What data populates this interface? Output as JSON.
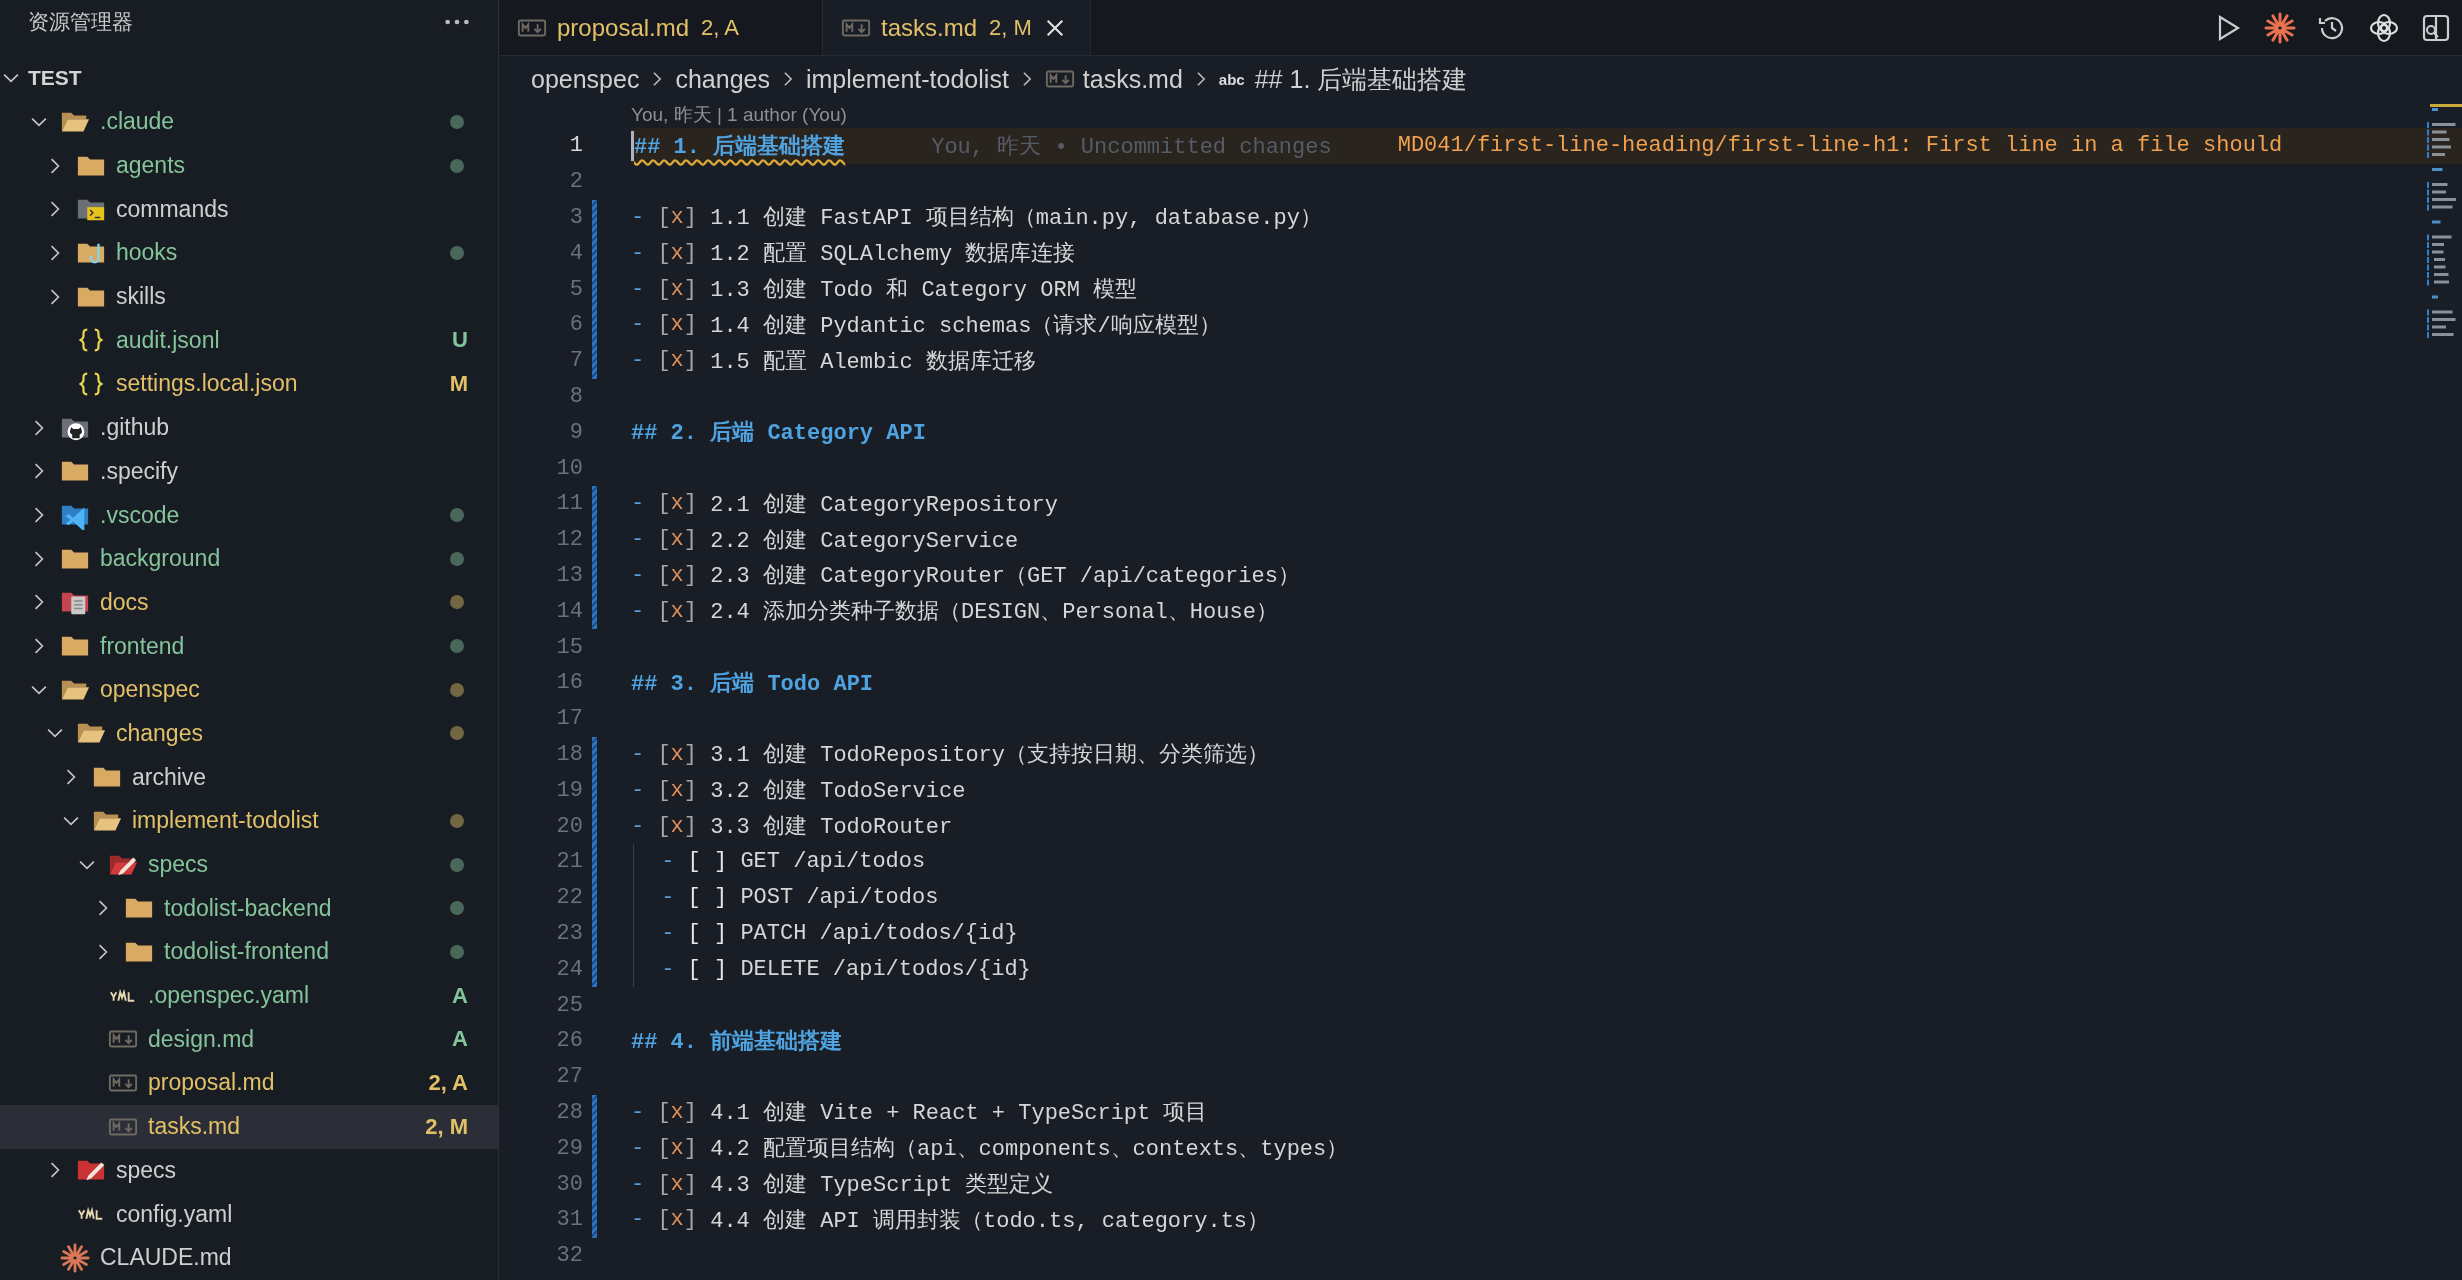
{
  "explorer": {
    "title": "资源管理器",
    "workspace": {
      "name": "TEST",
      "expanded": true
    },
    "tree": [
      {
        "name": ".claude",
        "kind": "folder",
        "color": "#84c49a",
        "dot": true,
        "expanded": true,
        "selected": false,
        "children": [
          {
            "name": "agents",
            "kind": "folder",
            "color": "#84c49a",
            "dot": true,
            "expanded": false,
            "selected": false
          },
          {
            "name": "commands",
            "kind": "commands",
            "dot": false,
            "expanded": false,
            "selected": false
          },
          {
            "name": "hooks",
            "kind": "hooks",
            "color": "#84c49a",
            "dot": true,
            "expanded": false,
            "selected": false
          },
          {
            "name": "skills",
            "kind": "folder",
            "dot": false,
            "expanded": false,
            "selected": false
          },
          {
            "name": "audit.jsonl",
            "kind": "json",
            "color": "#84c49a",
            "badge": "U",
            "selected": false
          },
          {
            "name": "settings.local.json",
            "kind": "json",
            "color": "#e2c067",
            "badge": "M",
            "selected": false
          }
        ]
      },
      {
        "name": ".github",
        "kind": "github",
        "dot": false,
        "expanded": false,
        "selected": false
      },
      {
        "name": ".specify",
        "kind": "folder",
        "dot": false,
        "expanded": false,
        "selected": false
      },
      {
        "name": ".vscode",
        "kind": "vscode",
        "color": "#84c49a",
        "dot": true,
        "expanded": false,
        "selected": false
      },
      {
        "name": "background",
        "kind": "folder",
        "color": "#84c49a",
        "dot": true,
        "expanded": false,
        "selected": false
      },
      {
        "name": "docs",
        "kind": "docs",
        "color": "#e2c067",
        "dot": true,
        "expanded": false,
        "selected": false
      },
      {
        "name": "frontend",
        "kind": "folder",
        "color": "#84c49a",
        "dot": true,
        "expanded": false,
        "selected": false
      },
      {
        "name": "openspec",
        "kind": "folder",
        "color": "#e2c067",
        "dot": true,
        "expanded": true,
        "selected": false,
        "children": [
          {
            "name": "changes",
            "kind": "folder",
            "color": "#e2c067",
            "dot": true,
            "expanded": true,
            "selected": false,
            "children": [
              {
                "name": "archive",
                "kind": "folder",
                "dot": false,
                "expanded": false,
                "selected": false
              },
              {
                "name": "implement-todolist",
                "kind": "folder",
                "color": "#e2c067",
                "dot": true,
                "expanded": true,
                "selected": false,
                "children": [
                  {
                    "name": "specs",
                    "kind": "specs",
                    "color": "#84c49a",
                    "dot": true,
                    "expanded": true,
                    "selected": false,
                    "children": [
                      {
                        "name": "todolist-backend",
                        "kind": "folder",
                        "color": "#84c49a",
                        "dot": true,
                        "expanded": false,
                        "selected": false
                      },
                      {
                        "name": "todolist-frontend",
                        "kind": "folder",
                        "color": "#84c49a",
                        "dot": true,
                        "expanded": false,
                        "selected": false
                      }
                    ]
                  },
                  {
                    "name": ".openspec.yaml",
                    "kind": "yaml",
                    "color": "#84c49a",
                    "badge": "A",
                    "selected": false
                  },
                  {
                    "name": "design.md",
                    "kind": "markdown",
                    "color": "#84c49a",
                    "badge": "A",
                    "selected": false
                  },
                  {
                    "name": "proposal.md",
                    "kind": "markdown",
                    "color": "#e2c067",
                    "badge": "2, A",
                    "selected": false
                  },
                  {
                    "name": "tasks.md",
                    "kind": "markdown",
                    "color": "#e2c067",
                    "badge": "2, M",
                    "selected": true
                  }
                ]
              }
            ]
          },
          {
            "name": "specs",
            "kind": "specs",
            "dot": false,
            "expanded": false,
            "selected": false
          },
          {
            "name": "config.yaml",
            "kind": "yaml",
            "selected": false
          }
        ]
      },
      {
        "name": "CLAUDE.md",
        "kind": "starburst",
        "selected": false
      }
    ]
  },
  "tabs": [
    {
      "label": "proposal.md",
      "badge": "2, A",
      "selected": false
    },
    {
      "label": "tasks.md",
      "badge": "2, M",
      "selected": true
    }
  ],
  "breadcrumbs": [
    {
      "text": "openspec"
    },
    {
      "text": "changes"
    },
    {
      "text": "implement-todolist"
    },
    {
      "text": "tasks.md",
      "kind": "markdown"
    },
    {
      "text": "## 1. 后端基础搭建",
      "symbol": "abc"
    }
  ],
  "codelens": "You, 昨天 | 1 author (You)",
  "lines": [
    {
      "number": "1",
      "kind": "heading",
      "text": "## 1. 后端基础搭建",
      "current": true,
      "squiggle": true,
      "blame": "You, 昨天 • Uncommitted changes",
      "diagnostic": "MD041/first-line-heading/first-line-h1: First line in a file should"
    },
    {
      "number": "2",
      "kind": "blank"
    },
    {
      "number": "3",
      "kind": "task",
      "bullet": "-",
      "box": "[x]",
      "checked": true,
      "changed": true,
      "text": "1.1 创建 FastAPI 项目结构（main.py, database.py）"
    },
    {
      "number": "4",
      "kind": "task",
      "bullet": "-",
      "box": "[x]",
      "checked": true,
      "changed": true,
      "text": "1.2 配置 SQLAlchemy 数据库连接"
    },
    {
      "number": "5",
      "kind": "task",
      "bullet": "-",
      "box": "[x]",
      "checked": true,
      "changed": true,
      "text": "1.3 创建 Todo 和 Category ORM 模型"
    },
    {
      "number": "6",
      "kind": "task",
      "bullet": "-",
      "box": "[x]",
      "checked": true,
      "changed": true,
      "text": "1.4 创建 Pydantic schemas（请求/响应模型）"
    },
    {
      "number": "7",
      "kind": "task",
      "bullet": "-",
      "box": "[x]",
      "checked": true,
      "changed": true,
      "text": "1.5 配置 Alembic 数据库迁移"
    },
    {
      "number": "8",
      "kind": "blank"
    },
    {
      "number": "9",
      "kind": "heading",
      "text": "## 2. 后端 Category API"
    },
    {
      "number": "10",
      "kind": "blank"
    },
    {
      "number": "11",
      "kind": "task",
      "bullet": "-",
      "box": "[x]",
      "checked": true,
      "changed": true,
      "text": "2.1 创建 CategoryRepository"
    },
    {
      "number": "12",
      "kind": "task",
      "bullet": "-",
      "box": "[x]",
      "checked": true,
      "changed": true,
      "text": "2.2 创建 CategoryService"
    },
    {
      "number": "13",
      "kind": "task",
      "bullet": "-",
      "box": "[x]",
      "checked": true,
      "changed": true,
      "text": "2.3 创建 CategoryRouter（GET /api/categories）"
    },
    {
      "number": "14",
      "kind": "task",
      "bullet": "-",
      "box": "[x]",
      "checked": true,
      "changed": true,
      "text": "2.4 添加分类种子数据（DESIGN、Personal、House）"
    },
    {
      "number": "15",
      "kind": "blank"
    },
    {
      "number": "16",
      "kind": "heading",
      "text": "## 3. 后端 Todo API"
    },
    {
      "number": "17",
      "kind": "blank"
    },
    {
      "number": "18",
      "kind": "task",
      "bullet": "-",
      "box": "[x]",
      "checked": true,
      "changed": true,
      "text": "3.1 创建 TodoRepository（支持按日期、分类筛选）"
    },
    {
      "number": "19",
      "kind": "task",
      "bullet": "-",
      "box": "[x]",
      "checked": true,
      "changed": true,
      "text": "3.2 创建 TodoService"
    },
    {
      "number": "20",
      "kind": "task",
      "bullet": "-",
      "box": "[x]",
      "checked": true,
      "changed": true,
      "text": "3.3 创建 TodoRouter",
      "children": [
        {
          "number": "21",
          "kind": "task",
          "bullet": "-",
          "box": "[ ]",
          "checked": false,
          "changed": true,
          "text": "GET /api/todos"
        },
        {
          "number": "22",
          "kind": "task",
          "bullet": "-",
          "box": "[ ]",
          "checked": false,
          "changed": true,
          "text": "POST /api/todos"
        },
        {
          "number": "23",
          "kind": "task",
          "bullet": "-",
          "box": "[ ]",
          "checked": false,
          "changed": true,
          "text": "PATCH /api/todos/{id}"
        },
        {
          "number": "24",
          "kind": "task",
          "bullet": "-",
          "box": "[ ]",
          "checked": false,
          "changed": true,
          "text": "DELETE /api/todos/{id}"
        }
      ]
    },
    {
      "number": "25",
      "kind": "blank"
    },
    {
      "number": "26",
      "kind": "heading",
      "text": "## 4. 前端基础搭建"
    },
    {
      "number": "27",
      "kind": "blank"
    },
    {
      "number": "28",
      "kind": "task",
      "bullet": "-",
      "box": "[x]",
      "checked": true,
      "changed": true,
      "text": "4.1 创建 Vite + React + TypeScript 项目"
    },
    {
      "number": "29",
      "kind": "task",
      "bullet": "-",
      "box": "[x]",
      "checked": true,
      "changed": true,
      "text": "4.2 配置项目结构（api、components、contexts、types）"
    },
    {
      "number": "30",
      "kind": "task",
      "bullet": "-",
      "box": "[x]",
      "checked": true,
      "changed": true,
      "text": "4.3 创建 TypeScript 类型定义"
    },
    {
      "number": "31",
      "kind": "task",
      "bullet": "-",
      "box": "[x]",
      "checked": true,
      "changed": true,
      "text": "4.4 创建 API 调用封装（todo.ts, category.ts）"
    },
    {
      "number": "32",
      "kind": "blank"
    }
  ]
}
